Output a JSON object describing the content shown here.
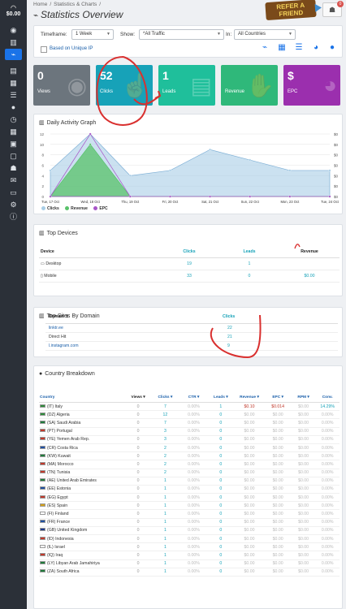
{
  "sidebar": {
    "balance": "$0.00",
    "items": [
      "dashboard",
      "statistics",
      "overview",
      "rows",
      "table",
      "list",
      "globe",
      "clock",
      "grid",
      "calculator",
      "doc",
      "users",
      "message",
      "id-card",
      "gear",
      "info"
    ]
  },
  "header": {
    "breadcrumb": [
      "Home",
      "/",
      "Statistics & Charts",
      "/"
    ],
    "title": "Statistics Overview",
    "refer_line1": "REFER A",
    "refer_line2": "FRIEND",
    "user_badge": "0"
  },
  "filters": {
    "timeframe_label": "Timeframe:",
    "timeframe_value": "1 Week",
    "show_label": "Show:",
    "show_value": "*All Traffic",
    "in_label": "In:",
    "in_value": "All Countries",
    "unique_ip_label": "Based on Unique IP"
  },
  "tiles": [
    {
      "value": "0",
      "label": "Views",
      "color": "#6c757d",
      "icon": "eye-icon"
    },
    {
      "value": "52",
      "label": "Clicks",
      "color": "#17a2b8",
      "icon": "pointer-icon"
    },
    {
      "value": "1",
      "label": "Leads",
      "color": "#1fbf9b",
      "icon": "clipboard-icon"
    },
    {
      "value": "",
      "label": "Revenue",
      "color": "#2fb87a",
      "icon": "handshake-icon"
    },
    {
      "value": "$",
      "label": "EPC",
      "color": "#9b2fae",
      "icon": "piechart-icon"
    }
  ],
  "chart": {
    "title": "Daily Activity Graph"
  },
  "chart_data": {
    "type": "area",
    "categories": [
      "Tue, 17 Oct",
      "Wed, 18 Oct",
      "Thu, 19 Oct",
      "Fri, 20 Oct",
      "Sat, 21 Oct",
      "Sun, 22 Oct",
      "Mon, 23 Oct",
      "Tue, 24 Oct"
    ],
    "series": [
      {
        "name": "Clicks",
        "color": "#a8cde6",
        "values": [
          5,
          12,
          4,
          5,
          9,
          7,
          5,
          5
        ]
      },
      {
        "name": "Revenue",
        "color": "#58c26a",
        "values": [
          0,
          10,
          0,
          0,
          0,
          0,
          0,
          0
        ]
      },
      {
        "name": "EPC",
        "color": "#a855c8",
        "values": [
          0,
          12,
          0,
          0,
          0,
          0,
          0,
          0
        ]
      }
    ],
    "ylim": [
      0,
      12
    ],
    "y_ticks": [
      "0",
      "2",
      "4",
      "6",
      "8",
      "10",
      "12"
    ],
    "y2_ticks": [
      "$0",
      "$0",
      "$0",
      "$0",
      "$0",
      "$0",
      "$0"
    ],
    "legend": "bottom-left"
  },
  "devices": {
    "title": "Top Devices",
    "cols": [
      "Device",
      "Clicks",
      "Leads",
      "Revenue"
    ],
    "rows": [
      [
        "Desktop",
        "19",
        "1",
        ""
      ],
      [
        "Mobile",
        "33",
        "0",
        "$0.00"
      ]
    ]
  },
  "domains": {
    "title": "Top Sites By Domain",
    "cols": [
      "Domain",
      "Clicks"
    ],
    "rows": [
      [
        "linktr.ee",
        "22"
      ],
      [
        "Direct Hit",
        "21"
      ],
      [
        "l.instagram.com",
        "9"
      ]
    ]
  },
  "countries": {
    "title": "Country Breakdown",
    "cols": [
      "Country",
      "Views",
      "Clicks",
      "CTR",
      "Leads",
      "Revenue",
      "EPC",
      "RPM",
      "Conv."
    ],
    "rows": [
      [
        "(IT) Italy",
        "0",
        "7",
        "0.00%",
        "1",
        "$0.10",
        "$0.014",
        "$0.00",
        "14.29%"
      ],
      [
        "(DZ) Algeria",
        "0",
        "12",
        "0.00%",
        "0",
        "$0.00",
        "$0.00",
        "$0.00",
        "0.00%"
      ],
      [
        "(SA) Saudi Arabia",
        "0",
        "7",
        "0.00%",
        "0",
        "$0.00",
        "$0.00",
        "$0.00",
        "0.00%"
      ],
      [
        "(PT) Portugal",
        "0",
        "3",
        "0.00%",
        "0",
        "$0.00",
        "$0.00",
        "$0.00",
        "0.00%"
      ],
      [
        "(YE) Yemen Arab Rep.",
        "0",
        "3",
        "0.00%",
        "0",
        "$0.00",
        "$0.00",
        "$0.00",
        "0.00%"
      ],
      [
        "(CR) Costa Rica",
        "0",
        "2",
        "0.00%",
        "0",
        "$0.00",
        "$0.00",
        "$0.00",
        "0.00%"
      ],
      [
        "(KW) Kuwait",
        "0",
        "2",
        "0.00%",
        "0",
        "$0.00",
        "$0.00",
        "$0.00",
        "0.00%"
      ],
      [
        "(MA) Morocco",
        "0",
        "2",
        "0.00%",
        "0",
        "$0.00",
        "$0.00",
        "$0.00",
        "0.00%"
      ],
      [
        "(TN) Tunisia",
        "0",
        "2",
        "0.00%",
        "0",
        "$0.00",
        "$0.00",
        "$0.00",
        "0.00%"
      ],
      [
        "(AE) United Arab Emirates",
        "0",
        "1",
        "0.00%",
        "0",
        "$0.00",
        "$0.00",
        "$0.00",
        "0.00%"
      ],
      [
        "(EE) Estonia",
        "0",
        "1",
        "0.00%",
        "0",
        "$0.00",
        "$0.00",
        "$0.00",
        "0.00%"
      ],
      [
        "(EG) Egypt",
        "0",
        "1",
        "0.00%",
        "0",
        "$0.00",
        "$0.00",
        "$0.00",
        "0.00%"
      ],
      [
        "(ES) Spain",
        "0",
        "1",
        "0.00%",
        "0",
        "$0.00",
        "$0.00",
        "$0.00",
        "0.00%"
      ],
      [
        "(FI) Finland",
        "0",
        "1",
        "0.00%",
        "0",
        "$0.00",
        "$0.00",
        "$0.00",
        "0.00%"
      ],
      [
        "(FR) France",
        "0",
        "1",
        "0.00%",
        "0",
        "$0.00",
        "$0.00",
        "$0.00",
        "0.00%"
      ],
      [
        "(GB) United Kingdom",
        "0",
        "1",
        "0.00%",
        "0",
        "$0.00",
        "$0.00",
        "$0.00",
        "0.00%"
      ],
      [
        "(ID) Indonesia",
        "0",
        "1",
        "0.00%",
        "0",
        "$0.00",
        "$0.00",
        "$0.00",
        "0.00%"
      ],
      [
        "(IL) Israel",
        "0",
        "1",
        "0.00%",
        "0",
        "$0.00",
        "$0.00",
        "$0.00",
        "0.00%"
      ],
      [
        "(IQ) Iraq",
        "0",
        "1",
        "0.00%",
        "0",
        "$0.00",
        "$0.00",
        "$0.00",
        "0.00%"
      ],
      [
        "(LY) Libyan Arab Jamahiriya",
        "0",
        "1",
        "0.00%",
        "0",
        "$0.00",
        "$0.00",
        "$0.00",
        "0.00%"
      ],
      [
        "(ZA) South Africa",
        "0",
        "1",
        "0.00%",
        "0",
        "$0.00",
        "$0.00",
        "$0.00",
        "0.00%"
      ]
    ],
    "flag_colors": [
      "#2e8b3a",
      "#2e8b3a",
      "#1e7a3a",
      "#c0392b",
      "#c0392b",
      "#1f4fa0",
      "#1f7a3a",
      "#c0392b",
      "#c0392b",
      "#1f7a3a",
      "#1f4fa0",
      "#c0392b",
      "#d4a017",
      "#ffffff",
      "#1f4fa0",
      "#1f3a8a",
      "#c0392b",
      "#ffffff",
      "#c0392b",
      "#1f7a3a",
      "#1f7a3a"
    ]
  }
}
